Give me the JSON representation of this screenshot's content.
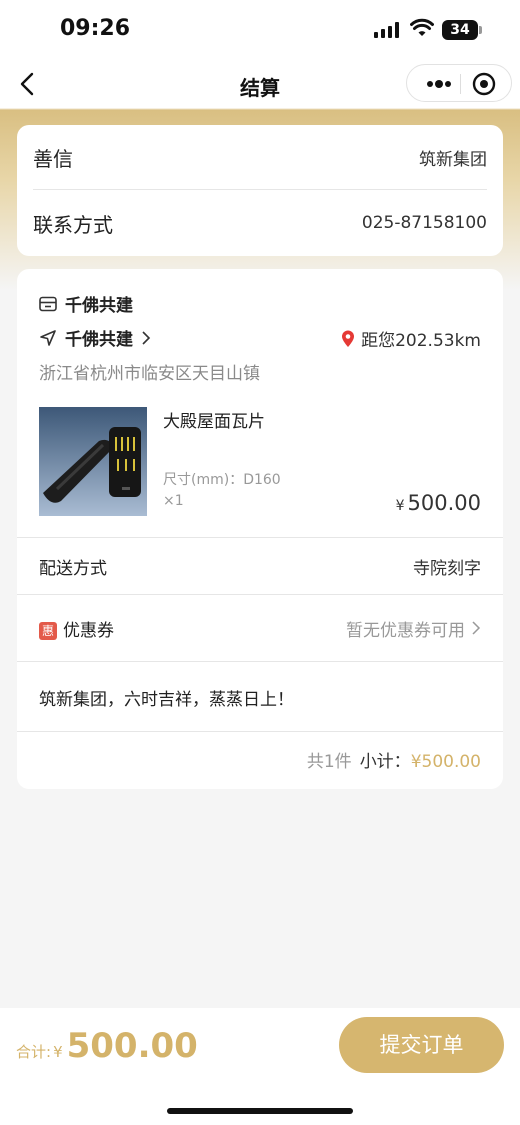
{
  "status_bar": {
    "time": "09:26",
    "battery": "34"
  },
  "nav": {
    "title": "结算"
  },
  "info": {
    "name_label": "善信",
    "name_value": "筑新集团",
    "contact_label": "联系方式",
    "contact_value": "025-87158100"
  },
  "order": {
    "shop_name": "千佛共建",
    "store_name": "千佛共建",
    "distance": "距您202.53km",
    "address": "浙江省杭州市临安区天目山镇",
    "product": {
      "name": "大殿屋面瓦片",
      "spec": "尺寸(mm)：D160",
      "qty": "×1",
      "currency": "¥",
      "price": "500.00"
    },
    "delivery_label": "配送方式",
    "delivery_value": "寺院刻字",
    "coupon_badge": "惠",
    "coupon_label": "优惠券",
    "coupon_value": "暂无优惠券可用",
    "message": "筑新集团，六时吉祥，蒸蒸日上！",
    "count": "共1件",
    "subtotal_label": "小计：",
    "subtotal_value": "¥500.00"
  },
  "footer": {
    "total_label": "合计:",
    "currency": "¥",
    "total_value": "500.00",
    "submit_label": "提交订单"
  },
  "colors": {
    "accent": "#d6b66f",
    "price": "#d4b36a",
    "coupon_badge": "#e35a4a",
    "location_pin": "#e53935"
  }
}
